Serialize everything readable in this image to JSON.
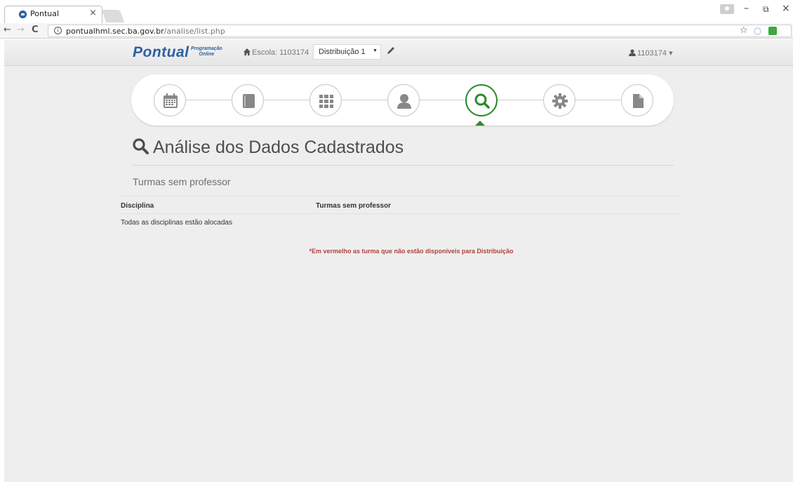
{
  "browser": {
    "tab_title": "Pontual",
    "tab_close": "×",
    "url_host": "pontualhml.sec.ba.gov.br",
    "url_path": "/analise/list.php",
    "info_glyph": "i",
    "nav_back": "←",
    "nav_forward": "→",
    "nav_reload": "C",
    "star": "☆",
    "win_minimize": "–",
    "win_restore": "⧉",
    "win_close": "×"
  },
  "navbar": {
    "brand": "Pontual",
    "brand_sub_1": "Programação",
    "brand_sub_2": "Online",
    "escola": "Escola: 1103174",
    "distribuicao": "Distribuição 1",
    "user": "1103174 ▾"
  },
  "steps": [
    {
      "icon": "calendar-icon"
    },
    {
      "icon": "book-icon"
    },
    {
      "icon": "grid-icon"
    },
    {
      "icon": "user-icon"
    },
    {
      "icon": "search-icon",
      "active": true
    },
    {
      "icon": "gear-icon"
    },
    {
      "icon": "document-icon"
    }
  ],
  "page": {
    "title": "Análise dos Dados Cadastrados",
    "section_title": "Turmas sem professor",
    "table_headers": [
      "Disciplina",
      "Turmas sem professor"
    ],
    "empty_message": "Todas as disciplinas estão alocadas",
    "footnote": "*Em vermelho as turma que não estão disponíveis para Distribuição"
  },
  "colors": {
    "brand": "#2d5fa3",
    "active_step": "#2a8a2a",
    "footnote": "#b0413e"
  }
}
